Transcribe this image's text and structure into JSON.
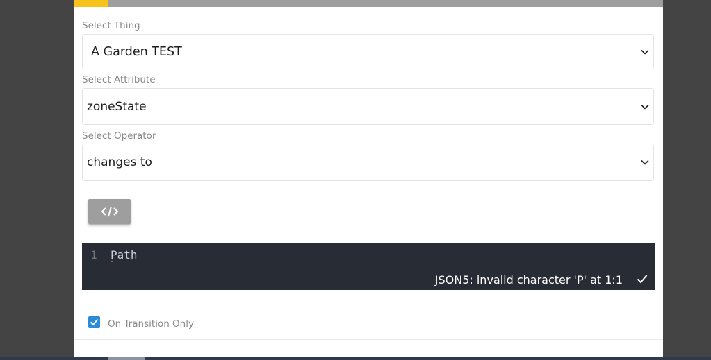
{
  "progress": {
    "fraction": 0.058,
    "fill_color": "#f7c21a",
    "track_color": "#9e9e9e"
  },
  "thing": {
    "label": "Select Thing",
    "value": "A Garden TEST",
    "icon": "chevron-down-icon"
  },
  "attribute": {
    "label": "Select Attribute",
    "value": "zoneState",
    "icon": "chevron-down-icon"
  },
  "operator": {
    "label": "Select Operator",
    "value": "changes to",
    "icon": "chevron-down-icon"
  },
  "code_toggle": {
    "icon": "code-icon",
    "glyph": "</>"
  },
  "editor": {
    "line_number": "1",
    "code": "Path",
    "status_message": "JSON5: invalid character 'P' at 1:1",
    "status_icon": "check-icon"
  },
  "transition": {
    "checked": true,
    "label": "On Transition Only",
    "color": "#2b8bd8"
  }
}
